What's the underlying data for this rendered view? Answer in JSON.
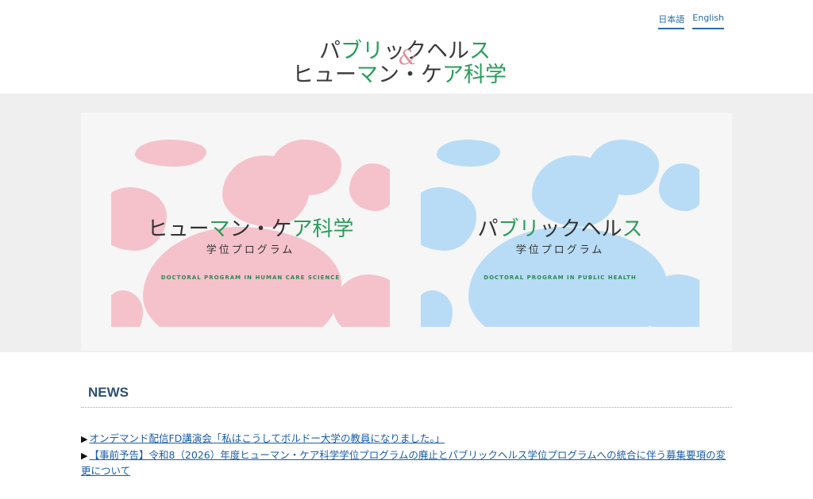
{
  "header": {
    "lang_ja": "日本語",
    "lang_en": "English",
    "logo_line1_a": "パ",
    "logo_line1_b": "ブ",
    "logo_line1_c": "リ",
    "logo_line1_d": "ックヘル",
    "logo_line1_e": "ス",
    "logo_amp": "&",
    "logo_line2_a": "ヒュー",
    "logo_line2_b": "マ",
    "logo_line2_c": "ン・ケ",
    "logo_line2_d": "ア",
    "logo_line2_e": "科学"
  },
  "programs": [
    {
      "title_a": "ヒュー",
      "title_b": "マ",
      "title_c": "ン・ケ",
      "title_d": "ア",
      "title_e": "科学",
      "subtitle": "学位プログラム",
      "english": "DOCTORAL PROGRAM IN HUMAN CARE SCIENCE",
      "blob_color": "#f5c2cb"
    },
    {
      "title_a": "パ",
      "title_b": "ブ",
      "title_c": "リ",
      "title_d": "ックヘル",
      "title_e": "ス",
      "subtitle": "学位プログラム",
      "english": "DOCTORAL PROGRAM IN PUBLIC HEALTH",
      "blob_color": "#b8dcf5"
    }
  ],
  "news": {
    "title": "NEWS",
    "items": [
      "オンデマンド配信FD講演会「私はこうしてボルドー大学の教員になりました。」",
      "【事前予告】令和8（2026）年度ヒューマン・ケア科学学位プログラムの廃止とパブリックヘルス学位プログラムへの統合に伴う募集要項の変更について"
    ]
  },
  "colors": {
    "accent_green": "#2a9d5b",
    "link_blue": "#1a5ea8",
    "pink": "#f5c2cb",
    "light_blue": "#b8dcf5"
  }
}
